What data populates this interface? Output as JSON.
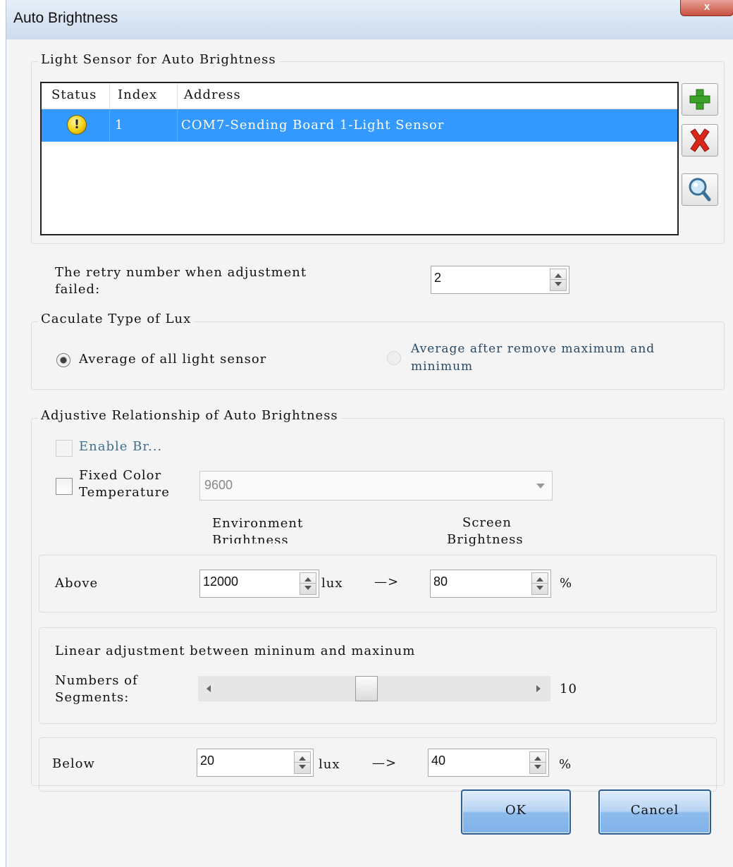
{
  "window": {
    "title": "Auto Brightness",
    "close_label": "x"
  },
  "sensor_group": {
    "title": "Light Sensor for Auto Brightness",
    "columns": [
      "Status",
      "Index",
      "Address"
    ],
    "rows": [
      {
        "status": "!",
        "index": "1",
        "address": "COM7-Sending Board 1-Light Sensor"
      }
    ],
    "tools": [
      "add-icon",
      "delete-icon",
      "search-icon"
    ]
  },
  "retry": {
    "label_line1": "The retry number when adjustment",
    "label_line2": "failed:",
    "value": "2"
  },
  "calc_group": {
    "title": "Caculate Type of Lux",
    "option1": "Average of all light sensor",
    "option2_line1": "Average after remove maximum and",
    "option2_line2": "minimum",
    "selected": "option1"
  },
  "adjust_group": {
    "title": "Adjustive Relationship of Auto Brightness",
    "enable_label": "Enable Br...",
    "fixed_color_line1": "Fixed Color",
    "fixed_color_line2": "Temperature",
    "color_temp_value": "9600",
    "env_header_line1": "Environment",
    "env_header_line2": "Brightness",
    "screen_header_line1": "Screen",
    "screen_header_line2": "Brightness",
    "above": {
      "label": "Above",
      "lux": "12000",
      "lux_unit": "lux",
      "arrow": "—>",
      "percent": "80",
      "percent_unit": "%"
    },
    "linear": {
      "label": "Linear adjustment between mininum and maxinum",
      "segments_line1": "Numbers of",
      "segments_line2": "Segments:",
      "segments_value": "10",
      "slider_fraction": 0.47
    },
    "below": {
      "label": "Below",
      "lux": "20",
      "lux_unit": "lux",
      "arrow": "—>",
      "percent": "40",
      "percent_unit": "%"
    }
  },
  "buttons": {
    "ok": "OK",
    "cancel": "Cancel"
  }
}
